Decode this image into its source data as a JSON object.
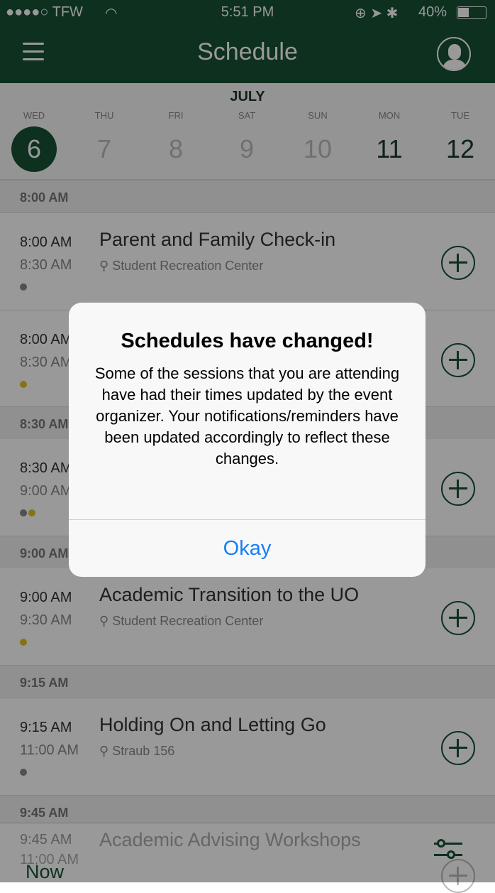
{
  "status_bar": {
    "carrier": "●●●●○ TFW",
    "time": "5:51 PM",
    "battery": "40%"
  },
  "nav": {
    "title": "Schedule",
    "menu_icon": "hamburger-icon",
    "profile_icon": "user-avatar-icon"
  },
  "calendar": {
    "month": "JULY",
    "days": [
      {
        "name": "WED",
        "num": "6"
      },
      {
        "name": "THU",
        "num": "7"
      },
      {
        "name": "FRI",
        "num": "8"
      },
      {
        "name": "SAT",
        "num": "9"
      },
      {
        "name": "SUN",
        "num": "10"
      },
      {
        "name": "MON",
        "num": "11"
      },
      {
        "name": "TUE",
        "num": "12"
      }
    ]
  },
  "sections": [
    "8:00 AM",
    "8:30 AM",
    "9:00 AM",
    "9:15 AM",
    "9:45 AM"
  ],
  "events": [
    {
      "start": "8:00 AM",
      "end": "8:30 AM",
      "title": "Parent and Family Check-in",
      "location": "Student Recreation Center"
    },
    {
      "start": "8:00 AM",
      "end": "8:30 AM"
    },
    {
      "start": "8:30 AM",
      "end": "9:00 AM"
    },
    {
      "start": "9:00 AM",
      "end": "9:30 AM",
      "title": "Academic Transition to the UO",
      "location": "Student Recreation Center"
    },
    {
      "start": "9:15 AM",
      "end": "11:00 AM",
      "title": "Holding On and Letting Go",
      "location": "Straub 156"
    },
    {
      "start": "9:45 AM",
      "end": "11:00 AM",
      "title": "Academic Advising Workshops"
    }
  ],
  "bottom": {
    "now_label": "Now",
    "filter_icon": "sliders-icon"
  },
  "dialog": {
    "title": "Schedules have changed!",
    "message": "Some of the sessions that you are attending have had their times updated by the event organizer. Your notifications/reminders have been updated accordingly to reflect these changes.",
    "ok_label": "Okay"
  },
  "colors": {
    "brand": "#165034",
    "dialog_button": "#157efb",
    "dot_gray": "#888888",
    "dot_yellow": "#e0c020"
  }
}
